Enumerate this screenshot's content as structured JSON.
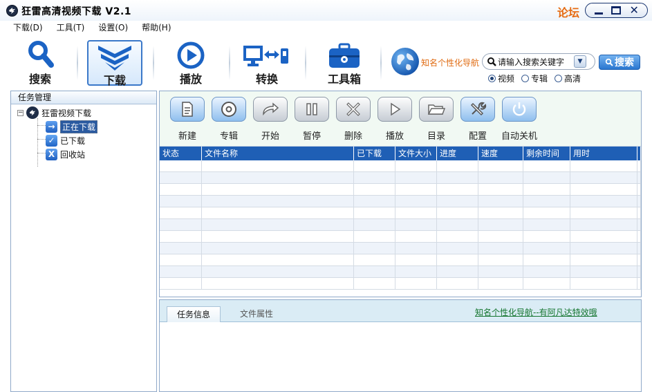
{
  "window": {
    "title": "狂雷高清视频下载 V2.1",
    "forum_link": "论坛"
  },
  "menu": [
    "下载(D)",
    "工具(T)",
    "设置(O)",
    "帮助(H)"
  ],
  "toolbar": {
    "items": [
      {
        "label": "搜索",
        "icon": "search-icon"
      },
      {
        "label": "下载",
        "icon": "download-icon",
        "active": true
      },
      {
        "label": "播放",
        "icon": "play-icon"
      },
      {
        "label": "转换",
        "icon": "convert-icon"
      },
      {
        "label": "工具箱",
        "icon": "toolbox-icon"
      }
    ],
    "nav_label": "知名个性化导航",
    "search_placeholder": "请输入搜索关键字",
    "search_button": "搜索",
    "radios": [
      {
        "label": "视频",
        "selected": true
      },
      {
        "label": "专辑",
        "selected": false
      },
      {
        "label": "高清",
        "selected": false
      }
    ]
  },
  "sidebar": {
    "header": "任务管理",
    "root": "狂雷视频下载",
    "items": [
      {
        "label": "正在下载",
        "icon": "arrow-right-icon",
        "selected": true
      },
      {
        "label": "已下载",
        "icon": "check-icon",
        "selected": false
      },
      {
        "label": "回收站",
        "icon": "recycle-x-icon",
        "selected": false
      }
    ]
  },
  "task_toolbar": [
    {
      "label": "新建",
      "icon": "new-file-icon"
    },
    {
      "label": "专辑",
      "icon": "disc-icon"
    },
    {
      "label": "开始",
      "icon": "start-arrow-icon"
    },
    {
      "label": "暂停",
      "icon": "pause-icon"
    },
    {
      "label": "删除",
      "icon": "delete-icon"
    },
    {
      "label": "播放",
      "icon": "play-triangle-icon"
    },
    {
      "label": "目录",
      "icon": "folder-icon"
    },
    {
      "label": "配置",
      "icon": "tools-icon"
    },
    {
      "label": "自动关机",
      "icon": "power-icon"
    }
  ],
  "table": {
    "columns": [
      "状态",
      "文件名称",
      "已下载",
      "文件大小",
      "进度",
      "速度",
      "剩余时间",
      "用时"
    ],
    "rows": []
  },
  "bottom": {
    "tabs": [
      "任务信息",
      "文件属性"
    ],
    "link": "知名个性化导航--有阿凡达特效哦"
  },
  "colors": {
    "accent": "#1f5fb5",
    "forum": "#e66b12",
    "link_green": "#14752e"
  }
}
